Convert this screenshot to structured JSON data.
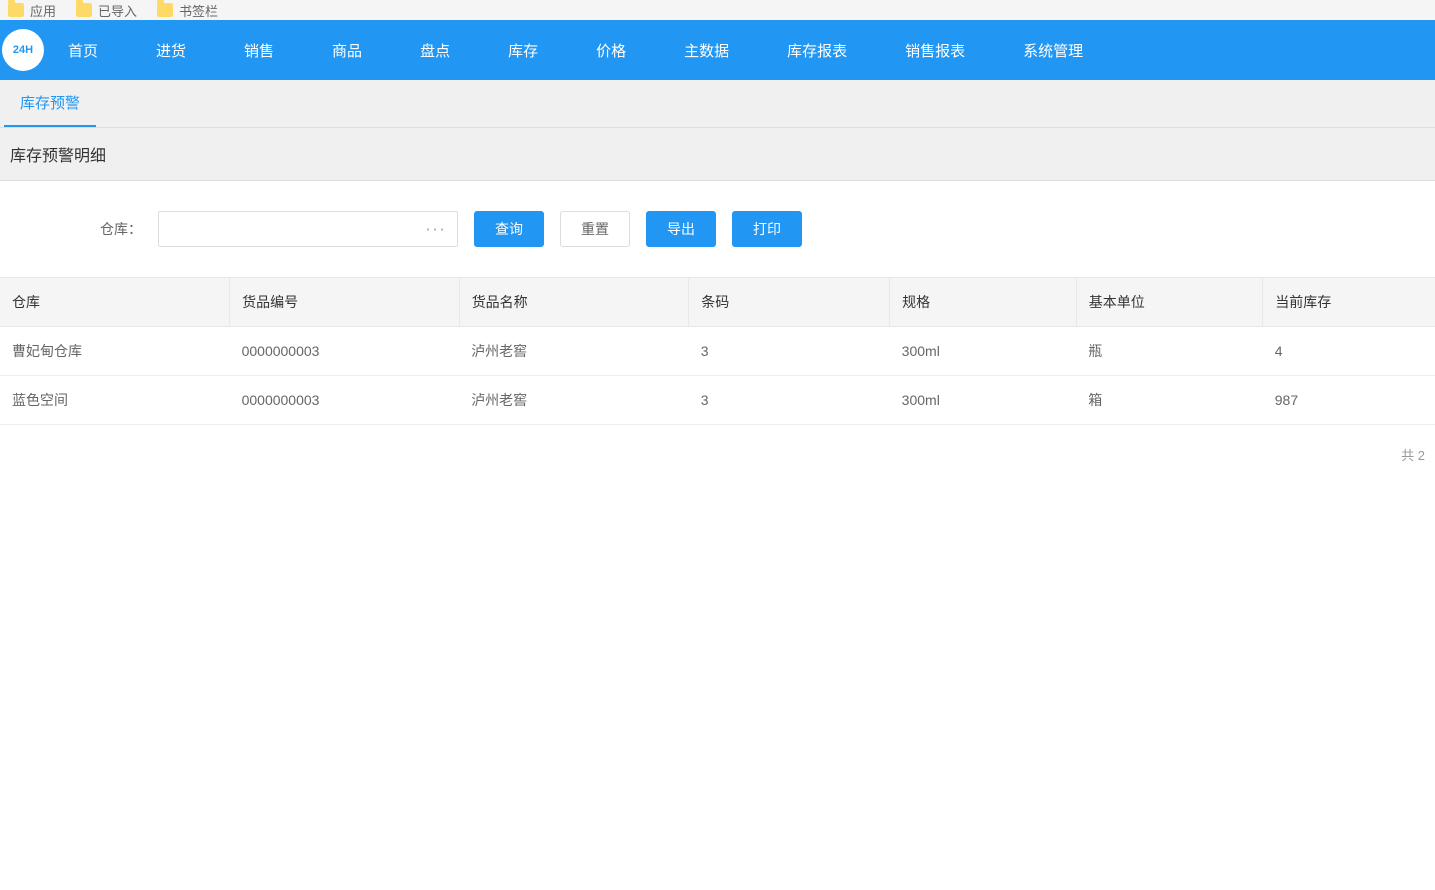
{
  "bookmarks": [
    "应用",
    "已导入",
    "书签栏"
  ],
  "logo_text": "24H",
  "nav": {
    "items": [
      "首页",
      "进货",
      "销售",
      "商品",
      "盘点",
      "库存",
      "价格",
      "主数据",
      "库存报表",
      "销售报表",
      "系统管理"
    ]
  },
  "tab": {
    "active": "库存预警"
  },
  "section_title": "库存预警明细",
  "filter": {
    "label": "仓库：",
    "value": "",
    "suffix": "···",
    "query_btn": "查询",
    "reset_btn": "重置",
    "export_btn": "导出",
    "print_btn": "打印"
  },
  "table": {
    "headers": [
      "仓库",
      "货品编号",
      "货品名称",
      "条码",
      "规格",
      "基本单位",
      "当前库存"
    ],
    "rows": [
      [
        "曹妃甸仓库",
        "0000000003",
        "泸州老窖",
        "3",
        "300ml",
        "瓶",
        "4"
      ],
      [
        "蓝色空间",
        "0000000003",
        "泸州老窖",
        "3",
        "300ml",
        "箱",
        "987"
      ]
    ]
  },
  "pagination": {
    "text": "共 2 "
  }
}
